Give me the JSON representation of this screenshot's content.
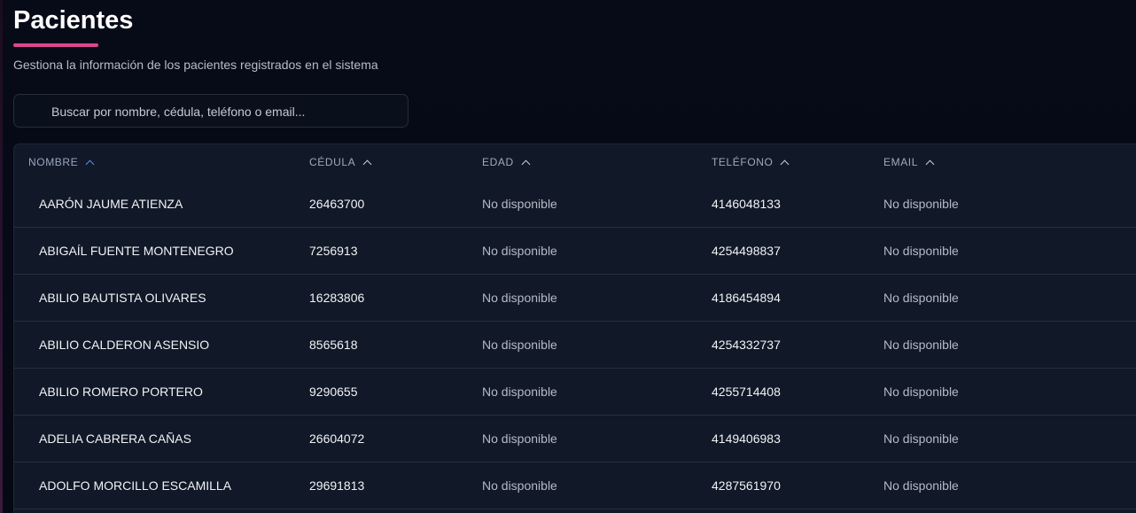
{
  "header": {
    "title": "Pacientes",
    "subtitle": "Gestiona la información de los pacientes registrados en el sistema",
    "accent_color": "#e0478f"
  },
  "search": {
    "placeholder": "Buscar por nombre, cédula, teléfono o email...",
    "value": ""
  },
  "table": {
    "columns": [
      "NOMBRE",
      "CÉDULA",
      "EDAD",
      "TELÉFONO",
      "EMAIL"
    ],
    "sort_icon": "chevron-up-icon",
    "active_sort_color": "#5b8ef0",
    "rows": [
      {
        "nombre": "AARÓN JAUME ATIENZA",
        "cedula": "26463700",
        "edad": "No disponible",
        "telefono": "4146048133",
        "email": "No disponible"
      },
      {
        "nombre": "ABIGAÍL FUENTE MONTENEGRO",
        "cedula": "7256913",
        "edad": "No disponible",
        "telefono": "4254498837",
        "email": "No disponible"
      },
      {
        "nombre": "ABILIO BAUTISTA OLIVARES",
        "cedula": "16283806",
        "edad": "No disponible",
        "telefono": "4186454894",
        "email": "No disponible"
      },
      {
        "nombre": "ABILIO CALDERON ASENSIO",
        "cedula": "8565618",
        "edad": "No disponible",
        "telefono": "4254332737",
        "email": "No disponible"
      },
      {
        "nombre": "ABILIO ROMERO PORTERO",
        "cedula": "9290655",
        "edad": "No disponible",
        "telefono": "4255714408",
        "email": "No disponible"
      },
      {
        "nombre": "ADELIA CABRERA CAÑAS",
        "cedula": "26604072",
        "edad": "No disponible",
        "telefono": "4149406983",
        "email": "No disponible"
      },
      {
        "nombre": "ADOLFO MORCILLO ESCAMILLA",
        "cedula": "29691813",
        "edad": "No disponible",
        "telefono": "4287561970",
        "email": "No disponible"
      }
    ]
  }
}
